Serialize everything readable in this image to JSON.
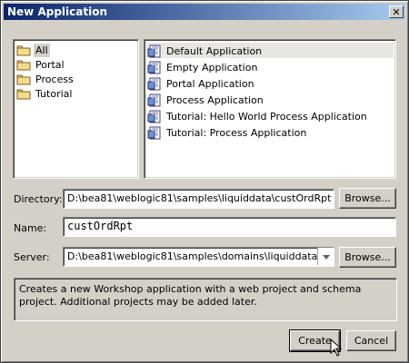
{
  "window": {
    "title": "New Application",
    "close_icon": "close-icon"
  },
  "categories": [
    {
      "label": "All",
      "icon": "folder-icon",
      "selected": true
    },
    {
      "label": "Portal",
      "icon": "folder-icon"
    },
    {
      "label": "Process",
      "icon": "folder-icon"
    },
    {
      "label": "Tutorial",
      "icon": "folder-icon"
    }
  ],
  "templates": [
    {
      "label": "Default Application",
      "icon": "application-icon",
      "selected": true
    },
    {
      "label": "Empty Application",
      "icon": "application-icon"
    },
    {
      "label": "Portal Application",
      "icon": "application-icon"
    },
    {
      "label": "Process Application",
      "icon": "application-icon"
    },
    {
      "label": "Tutorial: Hello World Process Application",
      "icon": "application-icon"
    },
    {
      "label": "Tutorial: Process Application",
      "icon": "application-icon"
    }
  ],
  "form": {
    "directory": {
      "label": "Directory:",
      "value": "D:\\bea81\\weblogic81\\samples\\liquiddata\\custOrdRpt",
      "browse_label": "Browse..."
    },
    "name": {
      "label": "Name:",
      "value": "custOrdRpt"
    },
    "server": {
      "label": "Server:",
      "value": "D:\\bea81\\weblogic81\\samples\\domains\\liquiddata",
      "browse_label": "Browse..."
    }
  },
  "description": "Creates a new Workshop application with a web project and schema project. Additional projects may be added later.",
  "buttons": {
    "create": "Create",
    "cancel": "Cancel"
  }
}
